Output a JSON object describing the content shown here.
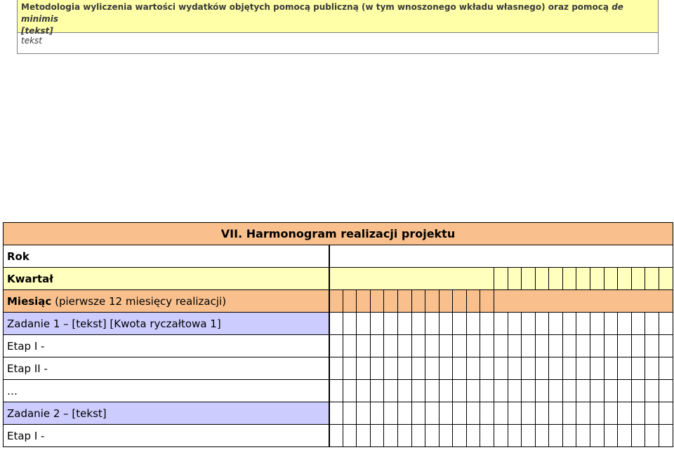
{
  "methodology": {
    "heading_main": "Metodologia wyliczenia wartości wydatków objętych pomocą publiczną (w tym wnoszonego wkładu własnego) oraz pomocą",
    "heading_italic": "de minimis",
    "heading_line2": "[tekst]",
    "body_text": "tekst"
  },
  "schedule": {
    "title": "VII. Harmonogram realizacji projektu",
    "rows": {
      "rok": "Rok",
      "kwartal": "Kwartał",
      "miesiac_bold": "Miesiąc",
      "miesiac_rest": " (pierwsze 12 miesięcy realizacji)",
      "zadanie1": "Zadanie 1 – [tekst] [Kwota ryczałtowa 1]",
      "etap1": "Etap I -",
      "etap2": "Etap II -",
      "ellipsis": "…",
      "zadanie2": "Zadanie 2 – [tekst]",
      "etap1b": "Etap I -"
    },
    "colors": {
      "title_bg": "#f9c08d",
      "year_quarter_bg": "#ffffbe",
      "month_bg": "#f9c08d",
      "task_bg": "#ccccff"
    }
  }
}
